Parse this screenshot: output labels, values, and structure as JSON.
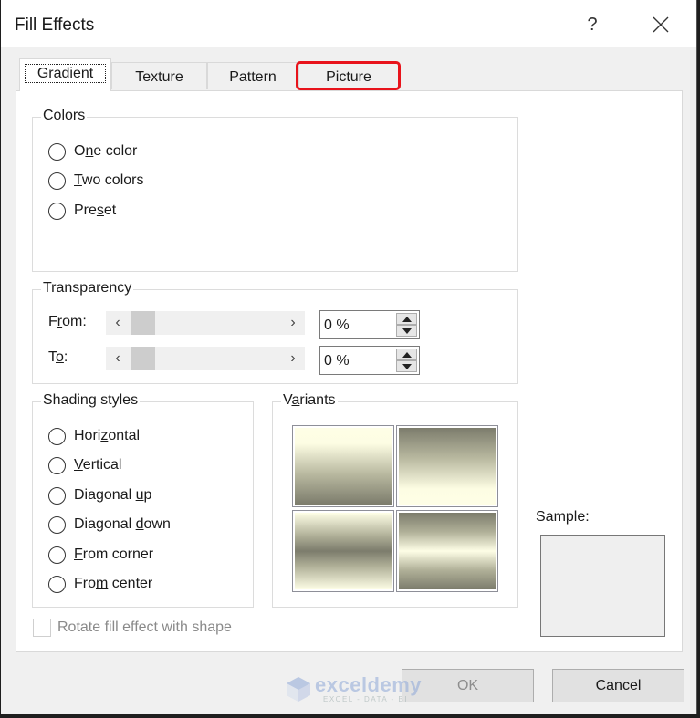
{
  "window": {
    "title": "Fill Effects",
    "help_label": "?",
    "close_icon": "close-icon"
  },
  "tabs": [
    {
      "label": "Gradient",
      "active": true
    },
    {
      "label": "Texture",
      "active": false
    },
    {
      "label": "Pattern",
      "active": false
    },
    {
      "label": "Picture",
      "active": false,
      "highlighted": true
    }
  ],
  "highlight_color": "#e8131b",
  "colors_group": {
    "title": "Colors",
    "options": [
      {
        "pre": "O",
        "accel": "n",
        "post": "e color",
        "checked": false
      },
      {
        "pre": "",
        "accel": "T",
        "post": "wo colors",
        "checked": false
      },
      {
        "pre": "Pre",
        "accel": "s",
        "post": "et",
        "checked": false
      }
    ]
  },
  "transparency_group": {
    "title": "Transparency",
    "from": {
      "pre": "F",
      "accel": "r",
      "post": "om:",
      "value": "0 %",
      "slider_percent": 0
    },
    "to": {
      "pre": "T",
      "accel": "o",
      "post": ":",
      "value": "0 %",
      "slider_percent": 0
    }
  },
  "shading_group": {
    "title": "Shading styles",
    "options": [
      {
        "pre": "Hori",
        "accel": "z",
        "post": "ontal",
        "checked": false
      },
      {
        "pre": "",
        "accel": "V",
        "post": "ertical",
        "checked": false
      },
      {
        "pre": "Diagonal ",
        "accel": "u",
        "post": "p",
        "checked": false
      },
      {
        "pre": "Diagonal ",
        "accel": "d",
        "post": "own",
        "checked": false
      },
      {
        "pre": "",
        "accel": "F",
        "post": "rom corner",
        "checked": false
      },
      {
        "pre": "Fro",
        "accel": "m",
        "post": " center",
        "checked": false
      }
    ]
  },
  "variants_group": {
    "title_pre": "V",
    "title_accel": "a",
    "title_post": "riants",
    "gradient_colors": [
      "#fefee6",
      "#7c7c6c"
    ]
  },
  "sample": {
    "label": "Sample:"
  },
  "rotate_checkbox": {
    "label": "Rotate fill effect with shape",
    "checked": false,
    "disabled": true
  },
  "buttons": {
    "ok": "OK",
    "cancel": "Cancel"
  },
  "watermark": {
    "name": "exceldemy",
    "tagline": "EXCEL - DATA - BI"
  }
}
